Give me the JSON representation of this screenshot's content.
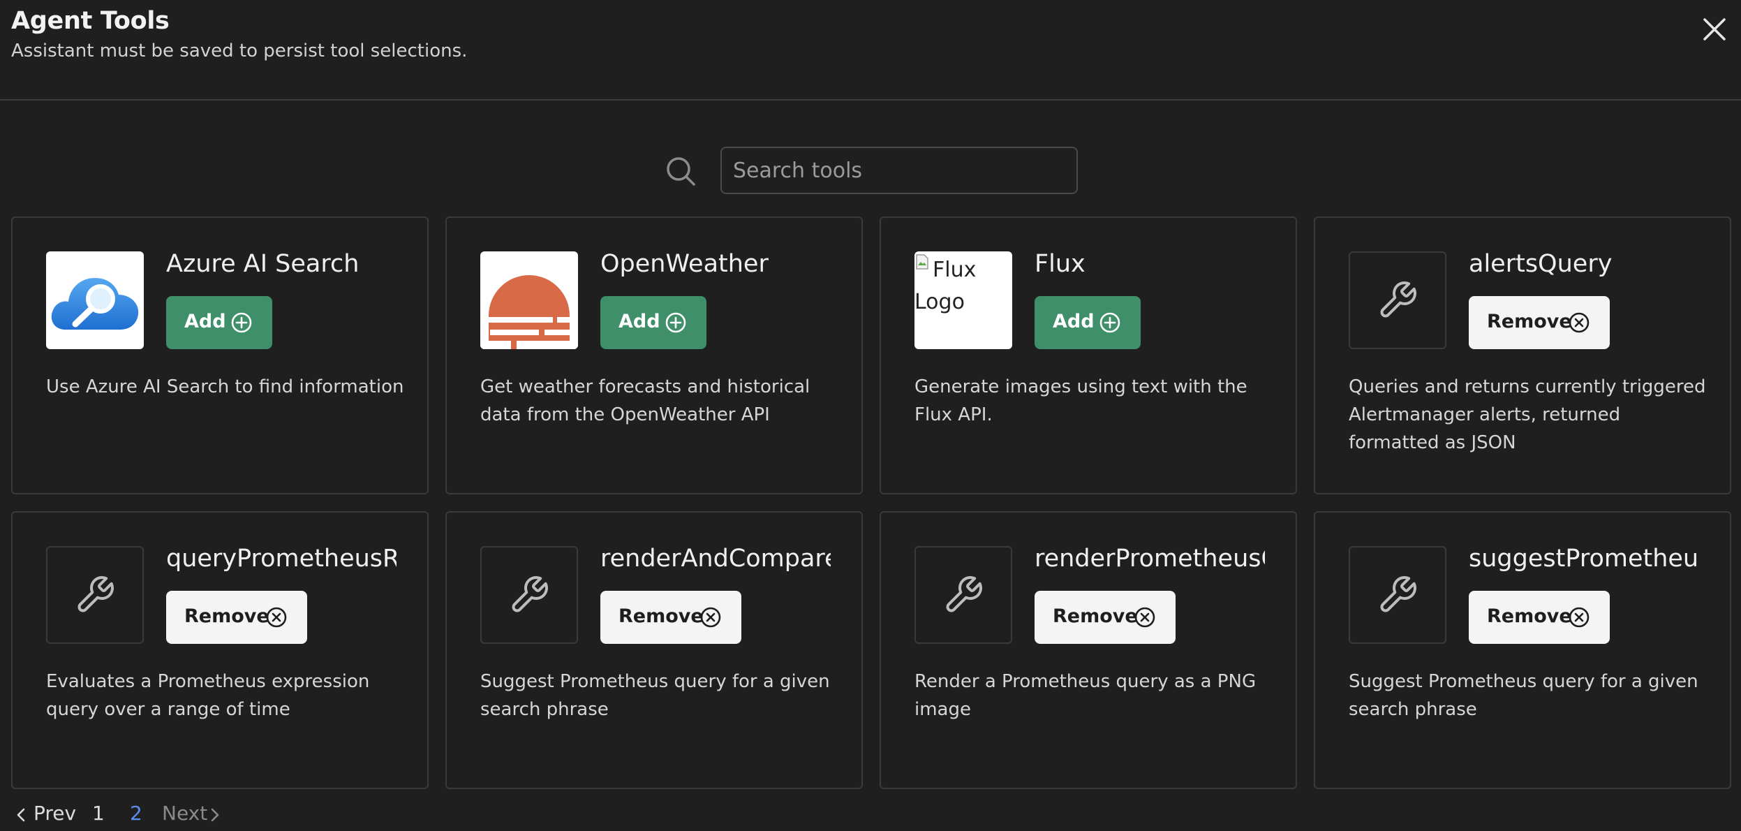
{
  "header": {
    "title": "Agent Tools",
    "subtitle": "Assistant must be saved to persist tool selections."
  },
  "search": {
    "placeholder": "Search tools",
    "value": ""
  },
  "tools": [
    {
      "name": "Azure AI Search",
      "action": "Add",
      "icon": "azure-ai-search-logo",
      "description": "Use Azure AI Search to find information"
    },
    {
      "name": "OpenWeather",
      "action": "Add",
      "icon": "openweather-logo",
      "description": "Get weather forecasts and historical data from the OpenWeather API"
    },
    {
      "name": "Flux",
      "action": "Add",
      "icon": "flux-logo-broken-image",
      "icon_alt": "Flux Logo",
      "description": "Generate images using text with the Flux API."
    },
    {
      "name": "alertsQuery",
      "action": "Remove",
      "icon": "wrench-icon",
      "description": "Queries and returns currently triggered Alertmanager alerts, returned formatted as JSON"
    },
    {
      "name": "queryPrometheusRa",
      "action": "Remove",
      "icon": "wrench-icon",
      "description": "Evaluates a Prometheus expression query over a range of time"
    },
    {
      "name": "renderAndCompareF",
      "action": "Remove",
      "icon": "wrench-icon",
      "description": "Suggest Prometheus query for a given search phrase"
    },
    {
      "name": "renderPrometheusQ",
      "action": "Remove",
      "icon": "wrench-icon",
      "description": "Render a Prometheus query as a PNG image"
    },
    {
      "name": "suggestPrometheus",
      "action": "Remove",
      "icon": "wrench-icon",
      "description": "Suggest Prometheus query for a given search phrase"
    }
  ],
  "pagination": {
    "prev_label": "Prev",
    "next_label": "Next",
    "pages": [
      "1",
      "2"
    ],
    "current_page": "2"
  },
  "colors": {
    "background": "#1f1f1f",
    "add_button": "#3f8f6b",
    "remove_button": "#f4f4f4",
    "active_page": "#5b8def",
    "card_border": "#3a3a3a"
  }
}
